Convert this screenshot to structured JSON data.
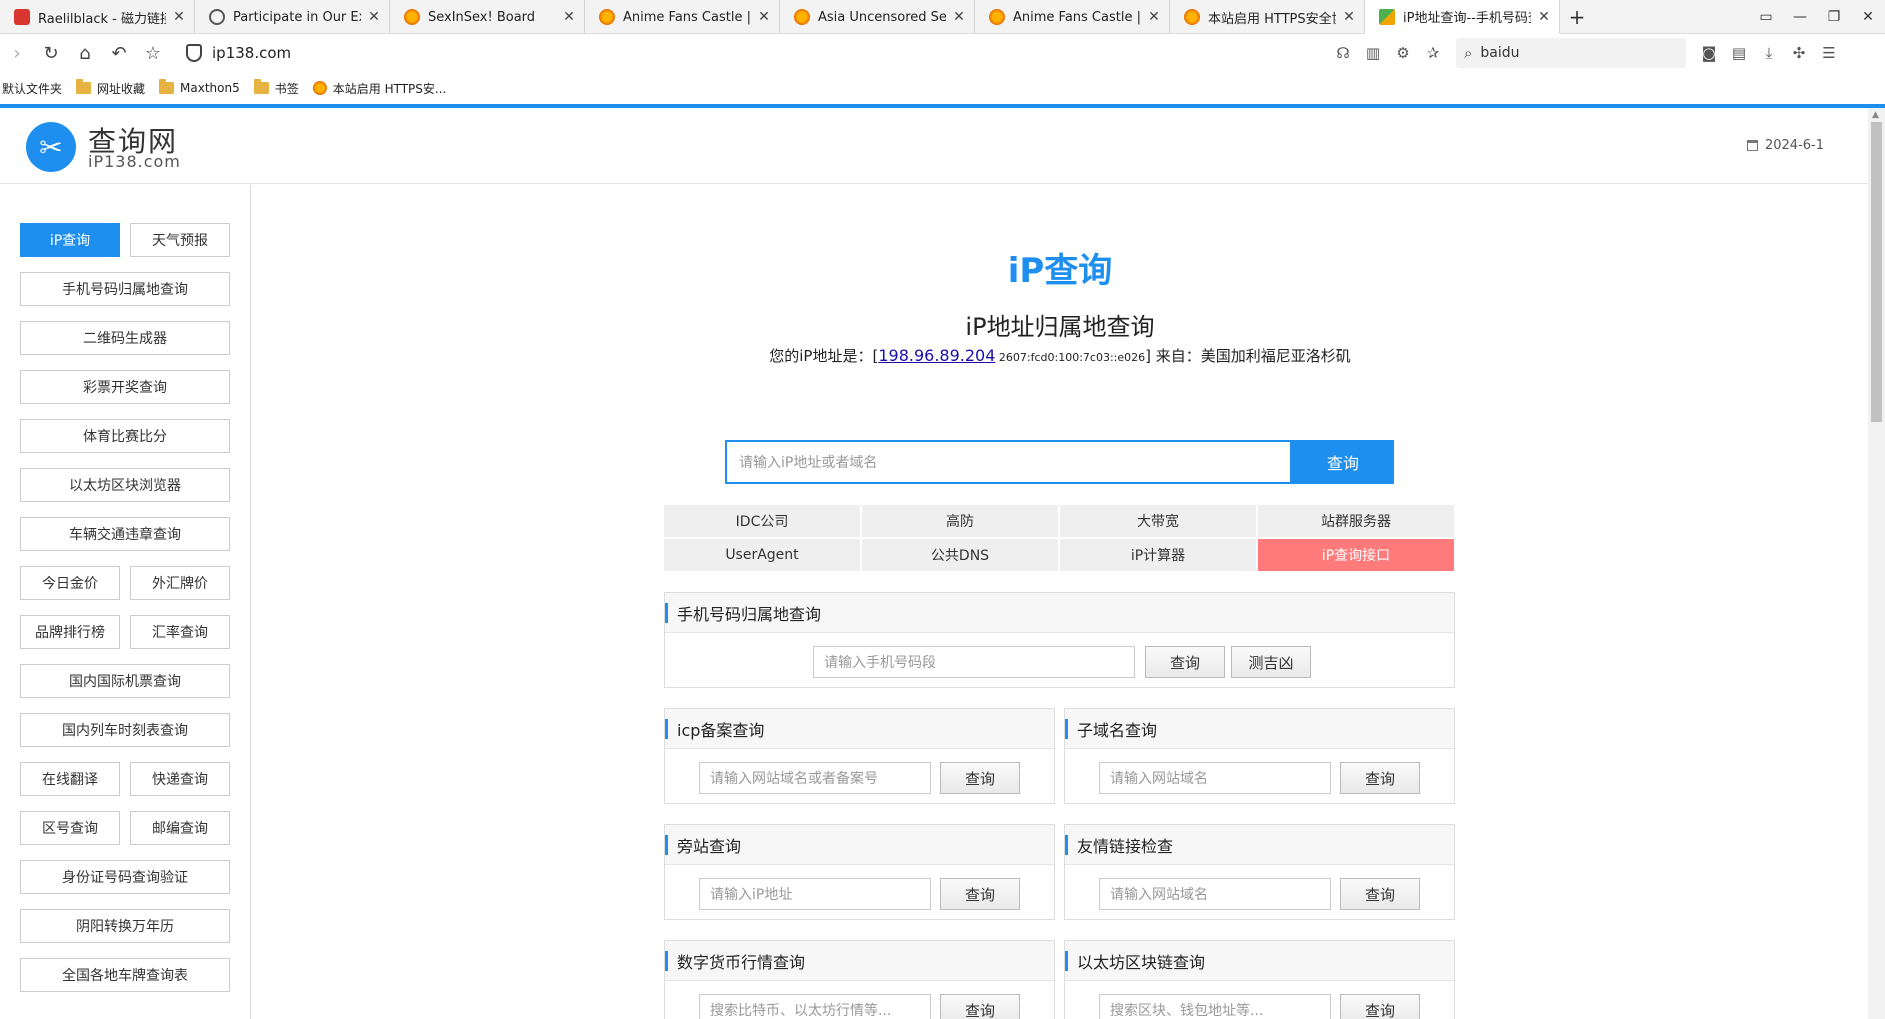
{
  "tabs": [
    {
      "title": "Raelilblack - 磁力链接",
      "icon": "red"
    },
    {
      "title": "Participate in Our Excl",
      "icon": "globe"
    },
    {
      "title": "SexInSex! Board",
      "icon": "orange"
    },
    {
      "title": "Anime Fans Castle | H",
      "icon": "orange"
    },
    {
      "title": "Asia Uncensored Secti",
      "icon": "orange"
    },
    {
      "title": "Anime Fans Castle | H",
      "icon": "orange"
    },
    {
      "title": "本站启用 HTTPS安全协",
      "icon": "orange"
    },
    {
      "title": "iP地址查询--手机号码查",
      "icon": "ip",
      "active": true
    }
  ],
  "browser": {
    "url": "ip138.com",
    "search_engine": "baidu"
  },
  "bookmarks": [
    {
      "label": "默认文件夹",
      "type": "text"
    },
    {
      "label": "网址收藏",
      "type": "folder"
    },
    {
      "label": "Maxthon5",
      "type": "folder"
    },
    {
      "label": "书签",
      "type": "folder"
    },
    {
      "label": "本站启用 HTTPS安...",
      "type": "site"
    }
  ],
  "site": {
    "name_cn": "查询网",
    "name_en": "iP138.com",
    "date": "2024-6-1"
  },
  "sidebar": {
    "items": [
      "iP查询",
      "天气预报",
      "手机号码归属地查询",
      "二维码生成器",
      "彩票开奖查询",
      "体育比赛比分",
      "以太坊区块浏览器",
      "车辆交通违章查询",
      "今日金价",
      "外汇牌价",
      "品牌排行榜",
      "汇率查询",
      "国内国际机票查询",
      "国内列车时刻表查询",
      "在线翻译",
      "快递查询",
      "区号查询",
      "邮编查询",
      "身份证号码查询验证",
      "阴阳转换万年历",
      "全国各地车牌查询表"
    ]
  },
  "hero": {
    "title": "iP查询",
    "subtitle": "iP地址归属地查询",
    "ip_prefix": "您的iP地址是：[",
    "ip": "198.96.89.204",
    "ipv6": " 2607:fcd0:100:7c03::e026",
    "ip_suffix": "] 来自：美国加利福尼亚洛杉矶",
    "search_placeholder": "请输入iP地址或者域名",
    "search_button": "查询"
  },
  "quick_links": [
    "IDC公司",
    "高防",
    "大带宽",
    "站群服务器",
    "UserAgent",
    "公共DNS",
    "iP计算器",
    "iP查询接口"
  ],
  "panels": {
    "mobile": {
      "title": "手机号码归属地查询",
      "placeholder": "请输入手机号码段",
      "button": "查询",
      "button2": "测吉凶"
    },
    "icp": {
      "title": "icp备案查询",
      "placeholder": "请输入网站域名或者备案号",
      "button": "查询"
    },
    "subdomain": {
      "title": "子域名查询",
      "placeholder": "请输入网站域名",
      "button": "查询"
    },
    "sidesite": {
      "title": "旁站查询",
      "placeholder": "请输入iP地址",
      "button": "查询"
    },
    "friendlink": {
      "title": "友情链接检查",
      "placeholder": "请输入网站域名",
      "button": "查询"
    },
    "crypto": {
      "title": "数字货币行情查询",
      "placeholder": "搜索比特币、以太坊行情等...",
      "button": "查询"
    },
    "eth": {
      "title": "以太坊区块链查询",
      "placeholder": "搜索区块、钱包地址等...",
      "button": "查询"
    }
  },
  "colors": {
    "accent": "#1f8fef",
    "hot_link": "#ff7a7a"
  }
}
